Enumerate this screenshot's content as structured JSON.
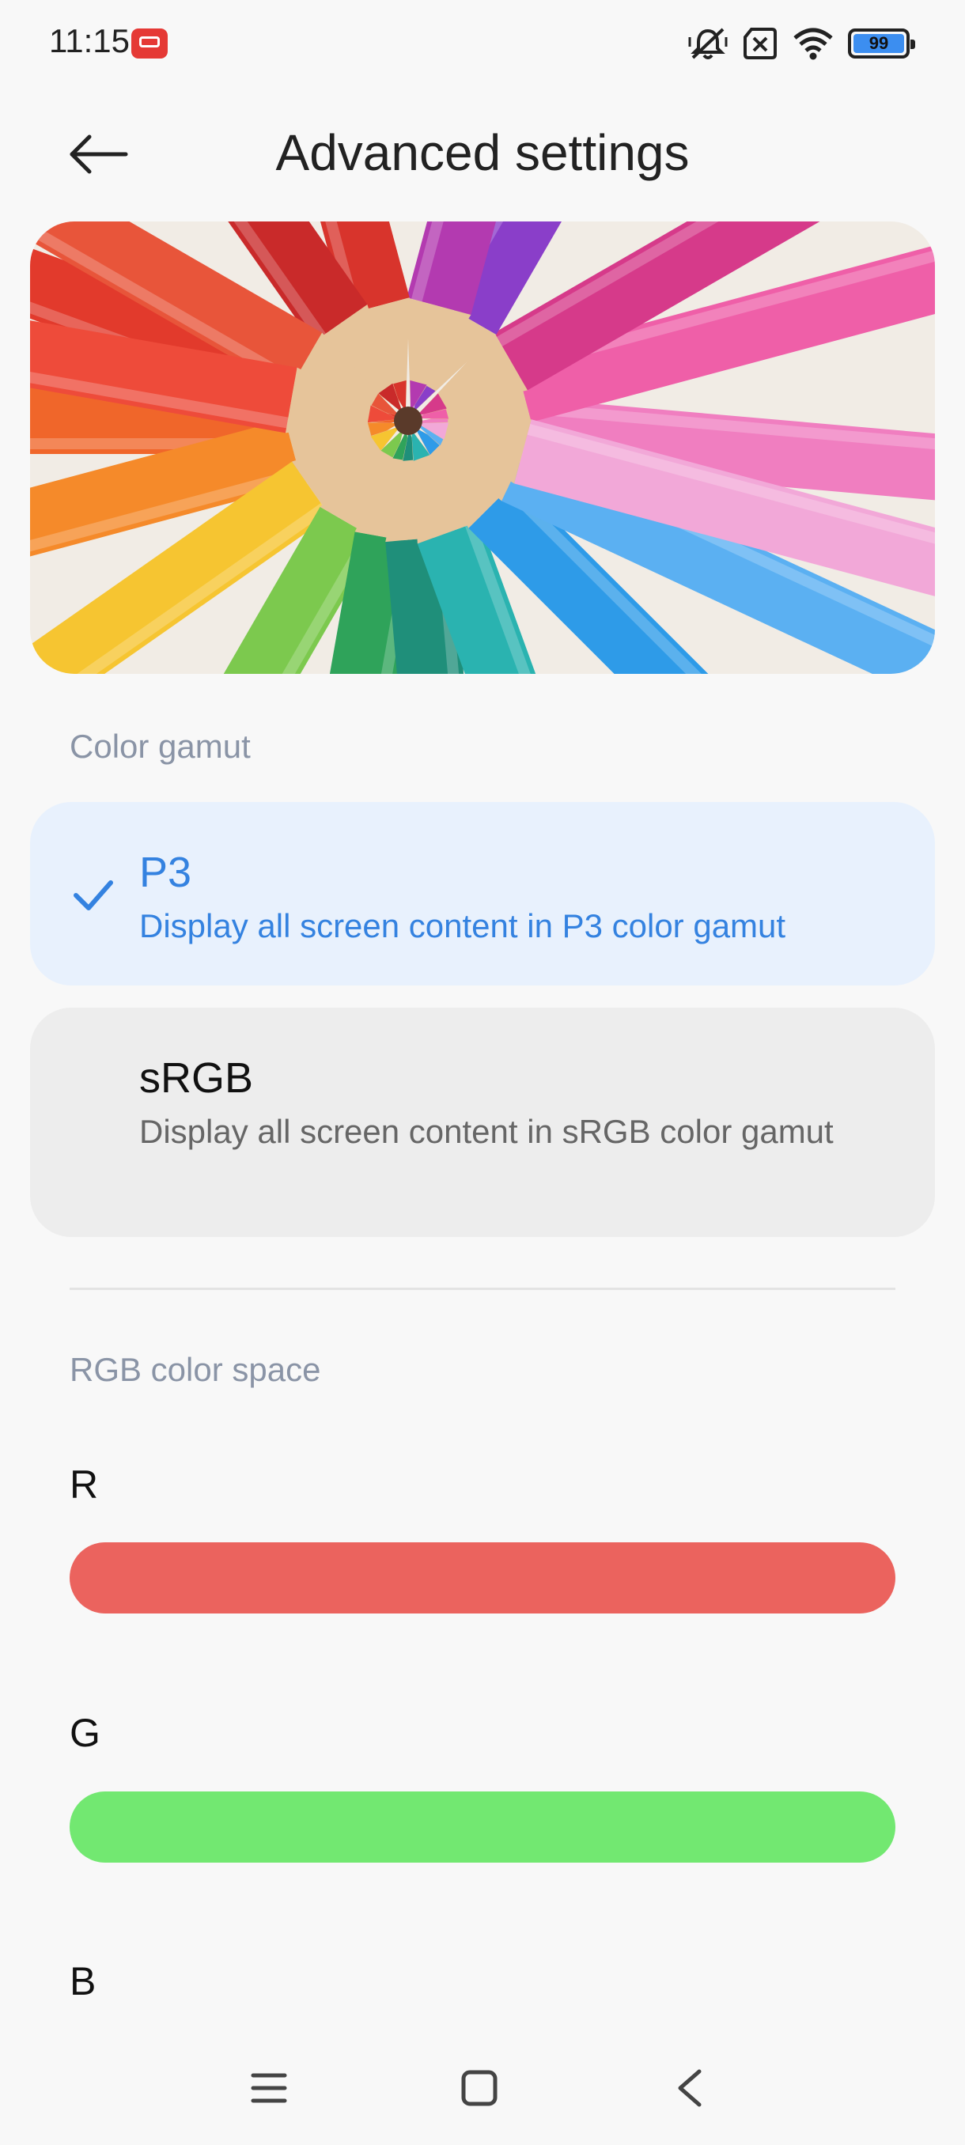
{
  "status_bar": {
    "time": "11:15",
    "battery": "99",
    "icons": [
      "app-notification-icon",
      "mute-vibrate-icon",
      "no-sim-icon",
      "wifi-icon",
      "battery-icon"
    ]
  },
  "header": {
    "title": "Advanced settings",
    "back_icon": "arrow-left-icon"
  },
  "color_gamut": {
    "label": "Color gamut",
    "options": [
      {
        "title": "P3",
        "description": "Display all screen content in P3 color gamut",
        "selected": true
      },
      {
        "title": "sRGB",
        "description": "Display all screen content in sRGB color gamut",
        "selected": false
      }
    ]
  },
  "rgb_color_space": {
    "label": "RGB color space",
    "channels": [
      {
        "label": "R",
        "color": "#eb635e"
      },
      {
        "label": "G",
        "color": "#72e871"
      },
      {
        "label": "B",
        "color": "#5a8ef0"
      }
    ]
  },
  "nav_bar": {
    "icons": [
      "menu-icon",
      "home-icon",
      "back-icon"
    ]
  },
  "colors": {
    "accent": "#3482e0",
    "selected_bg": "#e8f1fd",
    "unselected_bg": "#ededed"
  }
}
